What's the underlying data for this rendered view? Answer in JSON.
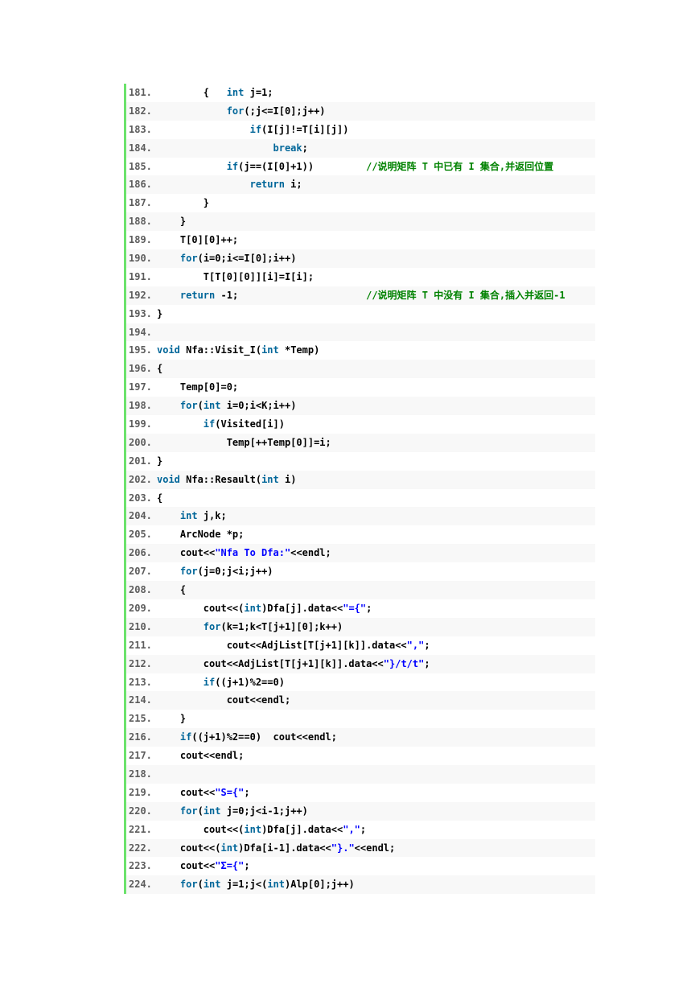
{
  "colors": {
    "gutter_border": "#6ce26c",
    "alt_row": "#f8f8f8",
    "keyword": "#006699",
    "string": "#0000ff",
    "comment": "#008200",
    "line_number": "#5c5c5c"
  },
  "lines": [
    {
      "num": "181.",
      "tokens": [
        {
          "t": "        {   "
        },
        {
          "t": "int",
          "c": "kw"
        },
        {
          "t": " j=1;"
        }
      ]
    },
    {
      "num": "182.",
      "tokens": [
        {
          "t": "            "
        },
        {
          "t": "for",
          "c": "kw"
        },
        {
          "t": "(;j<=I[0];j++)"
        }
      ]
    },
    {
      "num": "183.",
      "tokens": [
        {
          "t": "                "
        },
        {
          "t": "if",
          "c": "kw"
        },
        {
          "t": "(I[j]!=T[i][j])"
        }
      ]
    },
    {
      "num": "184.",
      "tokens": [
        {
          "t": "                    "
        },
        {
          "t": "break",
          "c": "kw"
        },
        {
          "t": ";"
        }
      ]
    },
    {
      "num": "185.",
      "tokens": [
        {
          "t": "            "
        },
        {
          "t": "if",
          "c": "kw"
        },
        {
          "t": "(j==(I[0]+1))         "
        },
        {
          "t": "//说明矩阵 T 中已有 I 集合,并返回位置",
          "c": "cm"
        }
      ]
    },
    {
      "num": "186.",
      "tokens": [
        {
          "t": "                "
        },
        {
          "t": "return",
          "c": "kw"
        },
        {
          "t": " i;"
        }
      ]
    },
    {
      "num": "187.",
      "tokens": [
        {
          "t": "        }"
        }
      ]
    },
    {
      "num": "188.",
      "tokens": [
        {
          "t": "    }"
        }
      ]
    },
    {
      "num": "189.",
      "tokens": [
        {
          "t": "    T[0][0]++;"
        }
      ]
    },
    {
      "num": "190.",
      "tokens": [
        {
          "t": "    "
        },
        {
          "t": "for",
          "c": "kw"
        },
        {
          "t": "(i=0;i<=I[0];i++)"
        }
      ]
    },
    {
      "num": "191.",
      "tokens": [
        {
          "t": "        T[T[0][0]][i]=I[i];"
        }
      ]
    },
    {
      "num": "192.",
      "tokens": [
        {
          "t": "    "
        },
        {
          "t": "return",
          "c": "kw"
        },
        {
          "t": " -1;                      "
        },
        {
          "t": "//说明矩阵 T 中没有 I 集合,插入并返回-1",
          "c": "cm"
        }
      ]
    },
    {
      "num": "193.",
      "tokens": [
        {
          "t": "}"
        }
      ]
    },
    {
      "num": "194.",
      "tokens": [
        {
          "t": ""
        }
      ]
    },
    {
      "num": "195.",
      "tokens": [
        {
          "t": "void",
          "c": "kw"
        },
        {
          "t": " Nfa::Visit_I("
        },
        {
          "t": "int",
          "c": "kw"
        },
        {
          "t": " *Temp)"
        }
      ]
    },
    {
      "num": "196.",
      "tokens": [
        {
          "t": "{"
        }
      ]
    },
    {
      "num": "197.",
      "tokens": [
        {
          "t": "    Temp[0]=0;"
        }
      ]
    },
    {
      "num": "198.",
      "tokens": [
        {
          "t": "    "
        },
        {
          "t": "for",
          "c": "kw"
        },
        {
          "t": "("
        },
        {
          "t": "int",
          "c": "kw"
        },
        {
          "t": " i=0;i<K;i++)"
        }
      ]
    },
    {
      "num": "199.",
      "tokens": [
        {
          "t": "        "
        },
        {
          "t": "if",
          "c": "kw"
        },
        {
          "t": "(Visited[i])"
        }
      ]
    },
    {
      "num": "200.",
      "tokens": [
        {
          "t": "            Temp[++Temp[0]]=i;"
        }
      ]
    },
    {
      "num": "201.",
      "tokens": [
        {
          "t": "}"
        }
      ]
    },
    {
      "num": "202.",
      "tokens": [
        {
          "t": "void",
          "c": "kw"
        },
        {
          "t": " Nfa::Resault("
        },
        {
          "t": "int",
          "c": "kw"
        },
        {
          "t": " i)"
        }
      ]
    },
    {
      "num": "203.",
      "tokens": [
        {
          "t": "{"
        }
      ]
    },
    {
      "num": "204.",
      "tokens": [
        {
          "t": "    "
        },
        {
          "t": "int",
          "c": "kw"
        },
        {
          "t": " j,k;"
        }
      ]
    },
    {
      "num": "205.",
      "tokens": [
        {
          "t": "    ArcNode *p;"
        }
      ]
    },
    {
      "num": "206.",
      "tokens": [
        {
          "t": "    cout<<"
        },
        {
          "t": "\"Nfa To Dfa:\"",
          "c": "str"
        },
        {
          "t": "<<endl;"
        }
      ]
    },
    {
      "num": "207.",
      "tokens": [
        {
          "t": "    "
        },
        {
          "t": "for",
          "c": "kw"
        },
        {
          "t": "(j=0;j<i;j++)"
        }
      ]
    },
    {
      "num": "208.",
      "tokens": [
        {
          "t": "    {"
        }
      ]
    },
    {
      "num": "209.",
      "tokens": [
        {
          "t": "        cout<<("
        },
        {
          "t": "int",
          "c": "kw"
        },
        {
          "t": ")Dfa[j].data<<"
        },
        {
          "t": "\"={\"",
          "c": "str"
        },
        {
          "t": ";"
        }
      ]
    },
    {
      "num": "210.",
      "tokens": [
        {
          "t": "        "
        },
        {
          "t": "for",
          "c": "kw"
        },
        {
          "t": "(k=1;k<T[j+1][0];k++)"
        }
      ]
    },
    {
      "num": "211.",
      "tokens": [
        {
          "t": "            cout<<AdjList[T[j+1][k]].data<<"
        },
        {
          "t": "\",\"",
          "c": "str"
        },
        {
          "t": ";"
        }
      ]
    },
    {
      "num": "212.",
      "tokens": [
        {
          "t": "        cout<<AdjList[T[j+1][k]].data<<"
        },
        {
          "t": "\"}/t/t\"",
          "c": "str"
        },
        {
          "t": ";"
        }
      ]
    },
    {
      "num": "213.",
      "tokens": [
        {
          "t": "        "
        },
        {
          "t": "if",
          "c": "kw"
        },
        {
          "t": "((j+1)%2==0)"
        }
      ]
    },
    {
      "num": "214.",
      "tokens": [
        {
          "t": "            cout<<endl;"
        }
      ]
    },
    {
      "num": "215.",
      "tokens": [
        {
          "t": "    }"
        }
      ]
    },
    {
      "num": "216.",
      "tokens": [
        {
          "t": "    "
        },
        {
          "t": "if",
          "c": "kw"
        },
        {
          "t": "((j+1)%2==0)  cout<<endl;"
        }
      ]
    },
    {
      "num": "217.",
      "tokens": [
        {
          "t": "    cout<<endl;"
        }
      ]
    },
    {
      "num": "218.",
      "tokens": [
        {
          "t": ""
        }
      ]
    },
    {
      "num": "219.",
      "tokens": [
        {
          "t": "    cout<<"
        },
        {
          "t": "\"S={\"",
          "c": "str"
        },
        {
          "t": ";"
        }
      ]
    },
    {
      "num": "220.",
      "tokens": [
        {
          "t": "    "
        },
        {
          "t": "for",
          "c": "kw"
        },
        {
          "t": "("
        },
        {
          "t": "int",
          "c": "kw"
        },
        {
          "t": " j=0;j<i-1;j++)"
        }
      ]
    },
    {
      "num": "221.",
      "tokens": [
        {
          "t": "        cout<<("
        },
        {
          "t": "int",
          "c": "kw"
        },
        {
          "t": ")Dfa[j].data<<"
        },
        {
          "t": "\",\"",
          "c": "str"
        },
        {
          "t": ";"
        }
      ]
    },
    {
      "num": "222.",
      "tokens": [
        {
          "t": "    cout<<("
        },
        {
          "t": "int",
          "c": "kw"
        },
        {
          "t": ")Dfa[i-1].data<<"
        },
        {
          "t": "\"}.\"",
          "c": "str"
        },
        {
          "t": "<<endl;"
        }
      ]
    },
    {
      "num": "223.",
      "tokens": [
        {
          "t": "    cout<<"
        },
        {
          "t": "\"Σ={\"",
          "c": "str"
        },
        {
          "t": ";"
        }
      ]
    },
    {
      "num": "224.",
      "tokens": [
        {
          "t": "    "
        },
        {
          "t": "for",
          "c": "kw"
        },
        {
          "t": "("
        },
        {
          "t": "int",
          "c": "kw"
        },
        {
          "t": " j=1;j<("
        },
        {
          "t": "int",
          "c": "kw"
        },
        {
          "t": ")Alp[0];j++)"
        }
      ]
    }
  ]
}
